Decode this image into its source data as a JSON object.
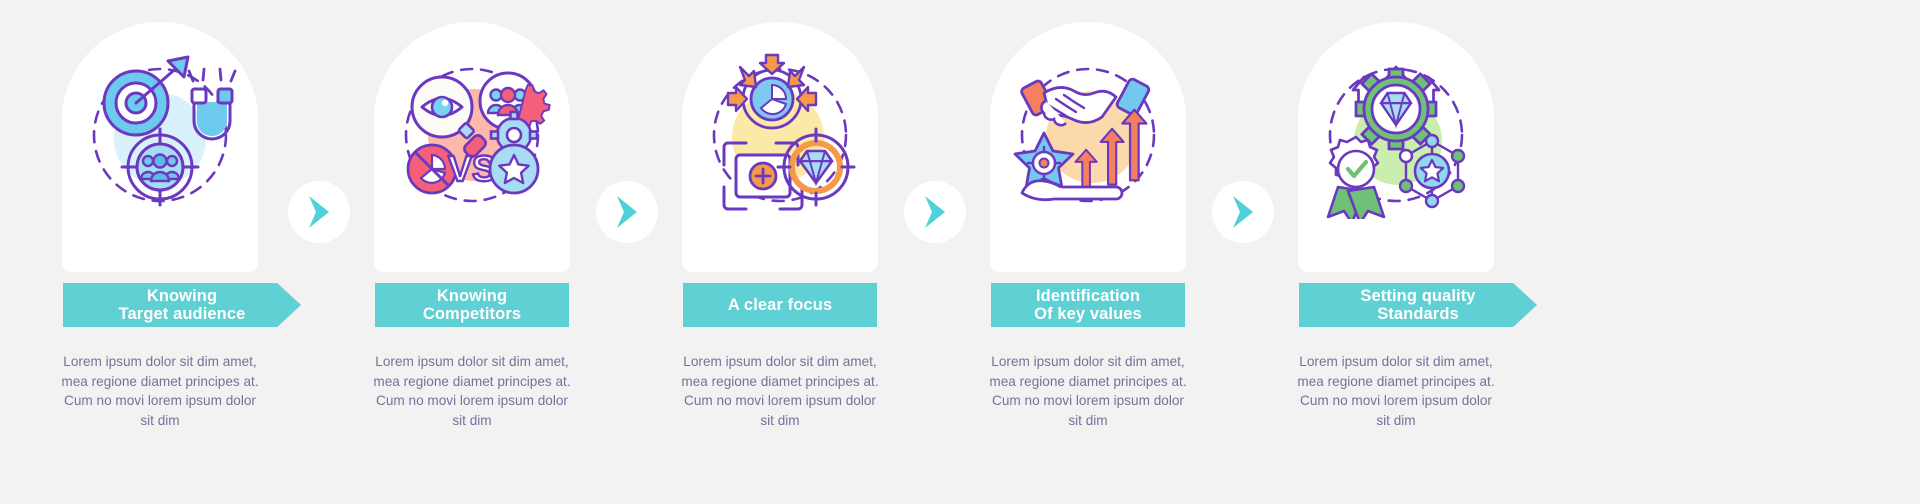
{
  "meta": {
    "title": "Business strategy steps infographic",
    "type": "process-infographic",
    "background_color": "#f2f2f2",
    "banner_color": "#5fd0d3",
    "banner_text_color": "#ffffff",
    "body_text_color": "#7b6f98",
    "card_color": "#ffffff",
    "arrow_color": "#4fd1d9",
    "step_count": 5
  },
  "body_text": "Lorem ipsum dolor sit dim amet, mea regione diamet principes at. Cum no movi lorem ipsum dolor sit dim",
  "steps": [
    {
      "label": "Knowing\nTarget audience",
      "label_line1": "Knowing",
      "label_line2": "Target audience",
      "description": "Lorem ipsum dolor sit dim amet, mea regione diamet principes at. Cum no movi lorem ipsum dolor sit dim",
      "icon_name": "target-audience-icon",
      "icon_parts": [
        "dartboard-with-arrow",
        "horseshoe-magnet",
        "people-group-in-crosshairs",
        "dashed-circle"
      ],
      "palette": {
        "primary": "#5bb8e8",
        "secondary": "#6ec9ef",
        "outline": "#6b38c0",
        "blob": "#d9f1fb"
      }
    },
    {
      "label": "Knowing\nCompetitors",
      "label_line1": "Knowing",
      "label_line2": "Competitors",
      "description": "Lorem ipsum dolor sit dim amet, mea regione diamet principes at. Cum no movi lorem ipsum dolor sit dim",
      "icon_name": "competitors-icon",
      "icon_parts": [
        "magnifier-with-eye",
        "people-group-circle",
        "gears",
        "vs-text",
        "blocked-pie-chart",
        "star-circle",
        "dashed-circle"
      ],
      "palette": {
        "primary": "#f4607a",
        "secondary": "#78d3ef",
        "outline": "#6b38c0",
        "blob": "#fbb8ab"
      }
    },
    {
      "label": "A clear focus",
      "label_line1": "A clear focus",
      "label_line2": "",
      "description": "Lorem ipsum dolor sit dim amet, mea regione diamet principes at. Cum no movi lorem ipsum dolor sit dim",
      "icon_name": "clear-focus-icon",
      "icon_parts": [
        "pie-chart-with-inward-arrows",
        "crop-frame-with-plus",
        "diamond-in-crosshair",
        "dashed-circle"
      ],
      "palette": {
        "primary": "#f59a4b",
        "secondary": "#7ec9f0",
        "outline": "#6b38c0",
        "blob": "#fbe9a8"
      }
    },
    {
      "label": "Identification\nOf key values",
      "label_line1": "Identification",
      "label_line2": "Of key values",
      "description": "Lorem ipsum dolor sit dim amet, mea regione diamet principes at. Cum no movi lorem ipsum dolor sit dim",
      "icon_name": "key-values-icon",
      "icon_parts": [
        "handshake",
        "ascending-arrows",
        "star-with-target",
        "open-hand",
        "dashed-circle"
      ],
      "palette": {
        "primary": "#f5805f",
        "secondary": "#72c8ef",
        "outline": "#6b38c0",
        "blob": "#fbd9ab"
      }
    },
    {
      "label": "Setting quality\nStandards",
      "label_line1": "Setting quality",
      "label_line2": "Standards",
      "description": "Lorem ipsum dolor sit dim amet, mea regione diamet principes at. Cum no movi lorem ipsum dolor sit dim",
      "icon_name": "quality-standards-icon",
      "icon_parts": [
        "gear-with-diamond",
        "upward-arrows",
        "award-ribbon-with-check",
        "hexagon-network-with-star",
        "dashed-circle"
      ],
      "palette": {
        "primary": "#6ec177",
        "secondary": "#8fd8ef",
        "outline": "#6b38c0",
        "blob": "#c9eeae"
      }
    }
  ],
  "connectors": [
    {
      "name": "chevron-1",
      "icon": "chevron-right-icon"
    },
    {
      "name": "chevron-2",
      "icon": "chevron-right-icon"
    },
    {
      "name": "chevron-3",
      "icon": "chevron-right-icon"
    },
    {
      "name": "chevron-4",
      "icon": "chevron-right-icon"
    }
  ]
}
